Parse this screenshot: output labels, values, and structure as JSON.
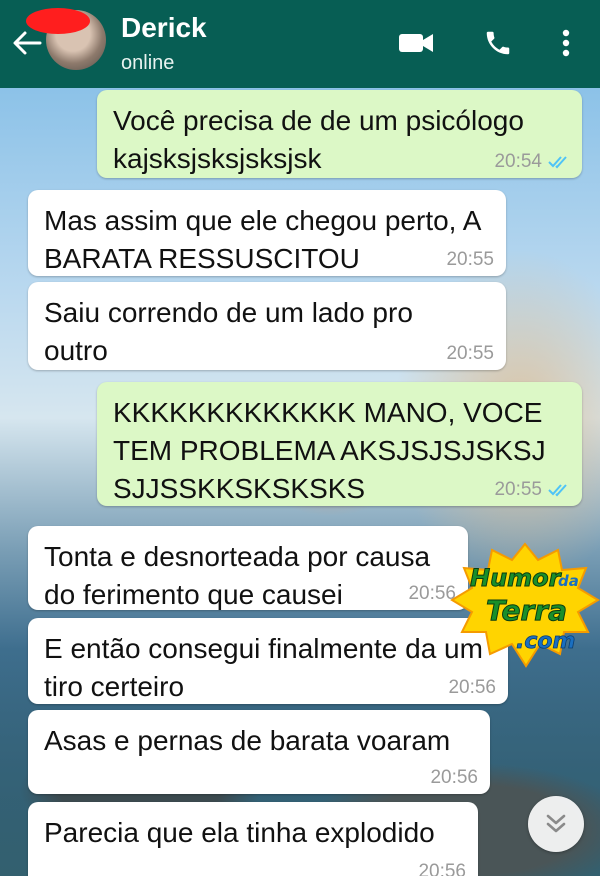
{
  "header": {
    "contact_name": "Derick",
    "status": "online",
    "back_icon": "arrow-left",
    "video_icon": "video-camera",
    "call_icon": "phone",
    "menu_icon": "more-vertical",
    "bg_color": "#075e54"
  },
  "messages": [
    {
      "direction": "out",
      "text": "Você precisa de de um psicólogo kajsksjsksjsksjsk",
      "time": "20:54",
      "read": true
    },
    {
      "direction": "in",
      "text": "Mas assim que ele chegou perto, A BARATA RESSUSCITOU",
      "time": "20:55"
    },
    {
      "direction": "in",
      "text": "Saiu correndo de um lado pro outro",
      "time": "20:55"
    },
    {
      "direction": "out",
      "text": "KKKKKKKKKKKKK MANO, VOCE TEM PROBLEMA AKSJSJSJSKSJ SJJSSKKSKSKSKS",
      "time": "20:55",
      "read": true
    },
    {
      "direction": "in",
      "text": "Tonta e desnorteada por causa do ferimento que causei",
      "time": "20:56"
    },
    {
      "direction": "in",
      "text": "E então consegui finalmente da um tiro certeiro",
      "time": "20:56"
    },
    {
      "direction": "in",
      "text": "Asas e pernas de barata voaram",
      "time": "20:56"
    },
    {
      "direction": "in",
      "text": "Parecia que ela tinha explodido",
      "time": "20:56"
    }
  ],
  "watermark": {
    "line1": "Humor",
    "line2": "da",
    "line3": "Terra",
    "line4": ".com"
  },
  "scroll_button_icon": "chevron-double-down",
  "colors": {
    "outgoing_bubble": "#dcf8c6",
    "incoming_bubble": "#ffffff",
    "read_ticks": "#4fc3f7"
  }
}
